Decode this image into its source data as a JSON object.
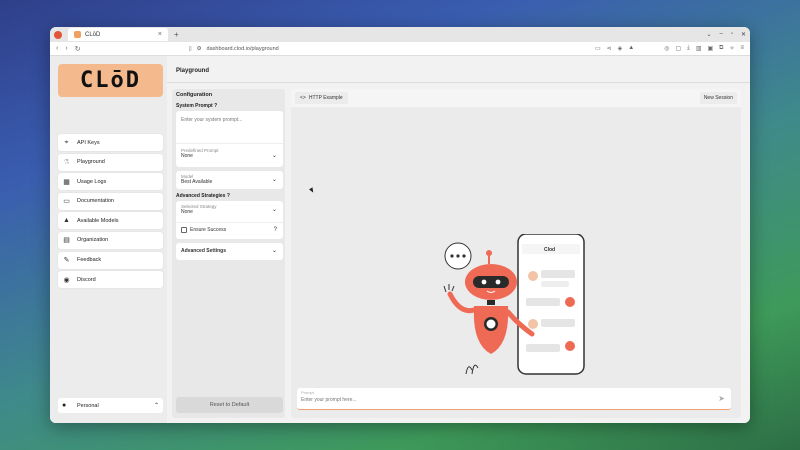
{
  "browser": {
    "tab_title": "CLōD",
    "tab_close": "×",
    "new_tab": "+",
    "url": "dashboard.clod.io/playground"
  },
  "sidebar": {
    "logo_text": "CLōD",
    "items": [
      {
        "label": "API Keys",
        "icon": "⌖"
      },
      {
        "label": "Playground",
        "icon": "⚗"
      },
      {
        "label": "Usage Logs",
        "icon": "▦"
      },
      {
        "label": "Documentation",
        "icon": "▭"
      },
      {
        "label": "Available Models",
        "icon": "▲"
      },
      {
        "label": "Organization",
        "icon": "▤"
      },
      {
        "label": "Feedback",
        "icon": "✎"
      },
      {
        "label": "Discord",
        "icon": "◉"
      }
    ],
    "account_label": "Personal"
  },
  "page": {
    "title": "Playground"
  },
  "config": {
    "heading": "Configuration",
    "system_prompt_label": "System Prompt ?",
    "system_prompt_placeholder": "Enter your system prompt...",
    "predefined_label": "Predefined Prompt",
    "predefined_value": "None",
    "model_label": "Model",
    "model_value": "Best Available",
    "advanced_strategies_label": "Advanced Strategies ?",
    "strategy_label": "Selected Strategy",
    "strategy_value": "None",
    "ensure_success_label": "Ensure Success",
    "ensure_help": "?",
    "advanced_settings_label": "Advanced Settings",
    "reset_label": "Reset to Default"
  },
  "main": {
    "http_example_label": "HTTP Example",
    "new_session_label": "New Session",
    "prompt_label": "Prompt",
    "prompt_placeholder": "Enter your prompt here...",
    "phone_title": "Clod"
  },
  "colors": {
    "logo_bg": "#f4b98c",
    "robot": "#ef6a55",
    "accent_line": "#f0a070"
  }
}
